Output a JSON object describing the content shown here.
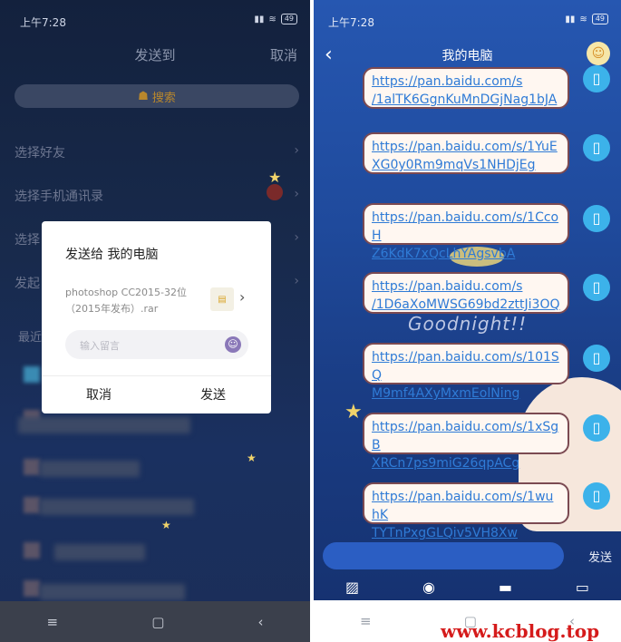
{
  "left_screen": {
    "status": {
      "time": "上午7:28",
      "battery": "49"
    },
    "header": {
      "title": "发送到",
      "cancel": "取消"
    },
    "search": {
      "label": "搜索"
    },
    "rows": [
      "选择好友",
      "选择手机通讯录",
      "选择",
      "发起"
    ],
    "recent_label": "最近",
    "dialog": {
      "title": "发送给 我的电脑",
      "file_name": "photoshop CC2015-32位（2015年发布）.rar",
      "input_placeholder": "输入留言",
      "cancel": "取消",
      "send": "发送"
    },
    "navbar": {
      "menu": "≡",
      "home": "▢",
      "back": "‹"
    }
  },
  "right_screen": {
    "status": {
      "time": "上午7:28",
      "battery": "49"
    },
    "header": {
      "back": "‹",
      "title": "我的电脑"
    },
    "messages": [
      {
        "line1": "https://pan.baidu.com/s",
        "line2": "/1alTK6GgnKuMnDGjNag1bJA"
      },
      {
        "line1": "https://pan.baidu.com/s/1YuE",
        "line2": "XG0y0Rm9mqVs1NHDjEg"
      },
      {
        "line1": "https://pan.baidu.com/s/1CcoH",
        "line2": "Z6KdK7xQcLhYAgsvbA"
      },
      {
        "line1": "https://pan.baidu.com/s",
        "line2": "/1D6aXoMWSG69bd2zttJi3OQ"
      },
      {
        "line1": "https://pan.baidu.com/s/101SQ",
        "line2": "M9mf4AXyMxmEolNing"
      },
      {
        "line1": "https://pan.baidu.com/s/1xSgB",
        "line2": "XRCn7ps9miG26qpACg"
      },
      {
        "line1": "https://pan.baidu.com/s/1wuhK",
        "line2": "TYTnPxgGLQiv5VH8Xw"
      }
    ],
    "wallpaper_text": "Goodnight!!",
    "input": {
      "send": "发送"
    },
    "navbar": {
      "menu": "≡",
      "home": "▢",
      "back": "‹"
    }
  },
  "watermark": "www.kcblog.top",
  "colors": {
    "left_bg": "#13213d",
    "right_bg": "#1f4a9c",
    "link": "#2f7bd6",
    "bubble_border": "#7b4a52",
    "pc_icon": "#3cb2ea",
    "watermark": "#d51b1b"
  }
}
